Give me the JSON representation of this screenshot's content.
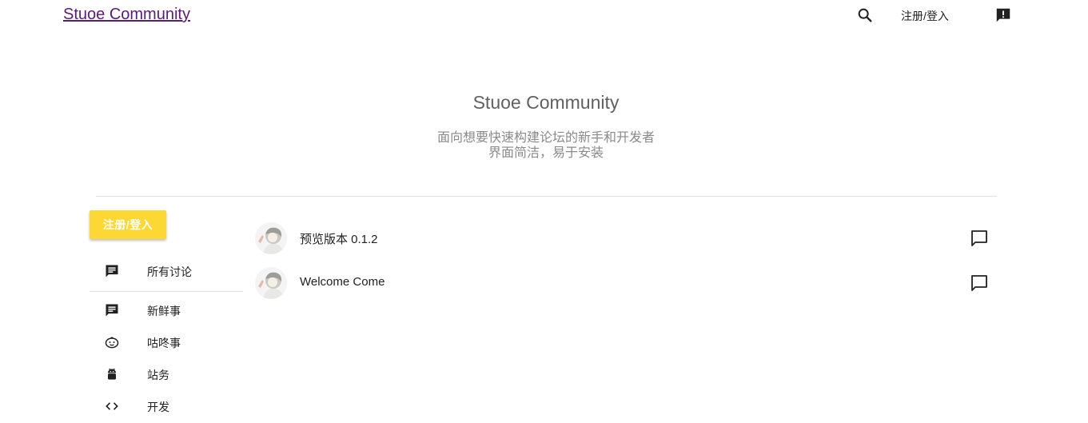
{
  "header": {
    "brand": "Stuoe Community",
    "login_label": "注册/登入",
    "search_icon": "search-icon",
    "feedback_icon": "feedback-icon"
  },
  "hero": {
    "title": "Stuoe Community",
    "line1": "面向想要快速构建论坛的新手和开发者",
    "line2": "界面简洁，易于安装"
  },
  "sidebar": {
    "cta_label": "注册/登入",
    "cta_color": "#fdd835",
    "items": [
      {
        "label": "所有讨论",
        "icon": "chat-bubble-icon"
      },
      {
        "label": "新鲜事",
        "icon": "chat-bubble-icon"
      },
      {
        "label": "咕咚事",
        "icon": "face-icon"
      },
      {
        "label": "站务",
        "icon": "android-icon"
      },
      {
        "label": "开发",
        "icon": "code-icon"
      }
    ]
  },
  "threads": [
    {
      "title": "预览版本 0.1.2",
      "icon": "comment-icon"
    },
    {
      "title": "Welcome Come",
      "icon": "comment-icon"
    }
  ],
  "colors": {
    "brand": "#5b1a7c",
    "divider": "#e0e0e0"
  }
}
